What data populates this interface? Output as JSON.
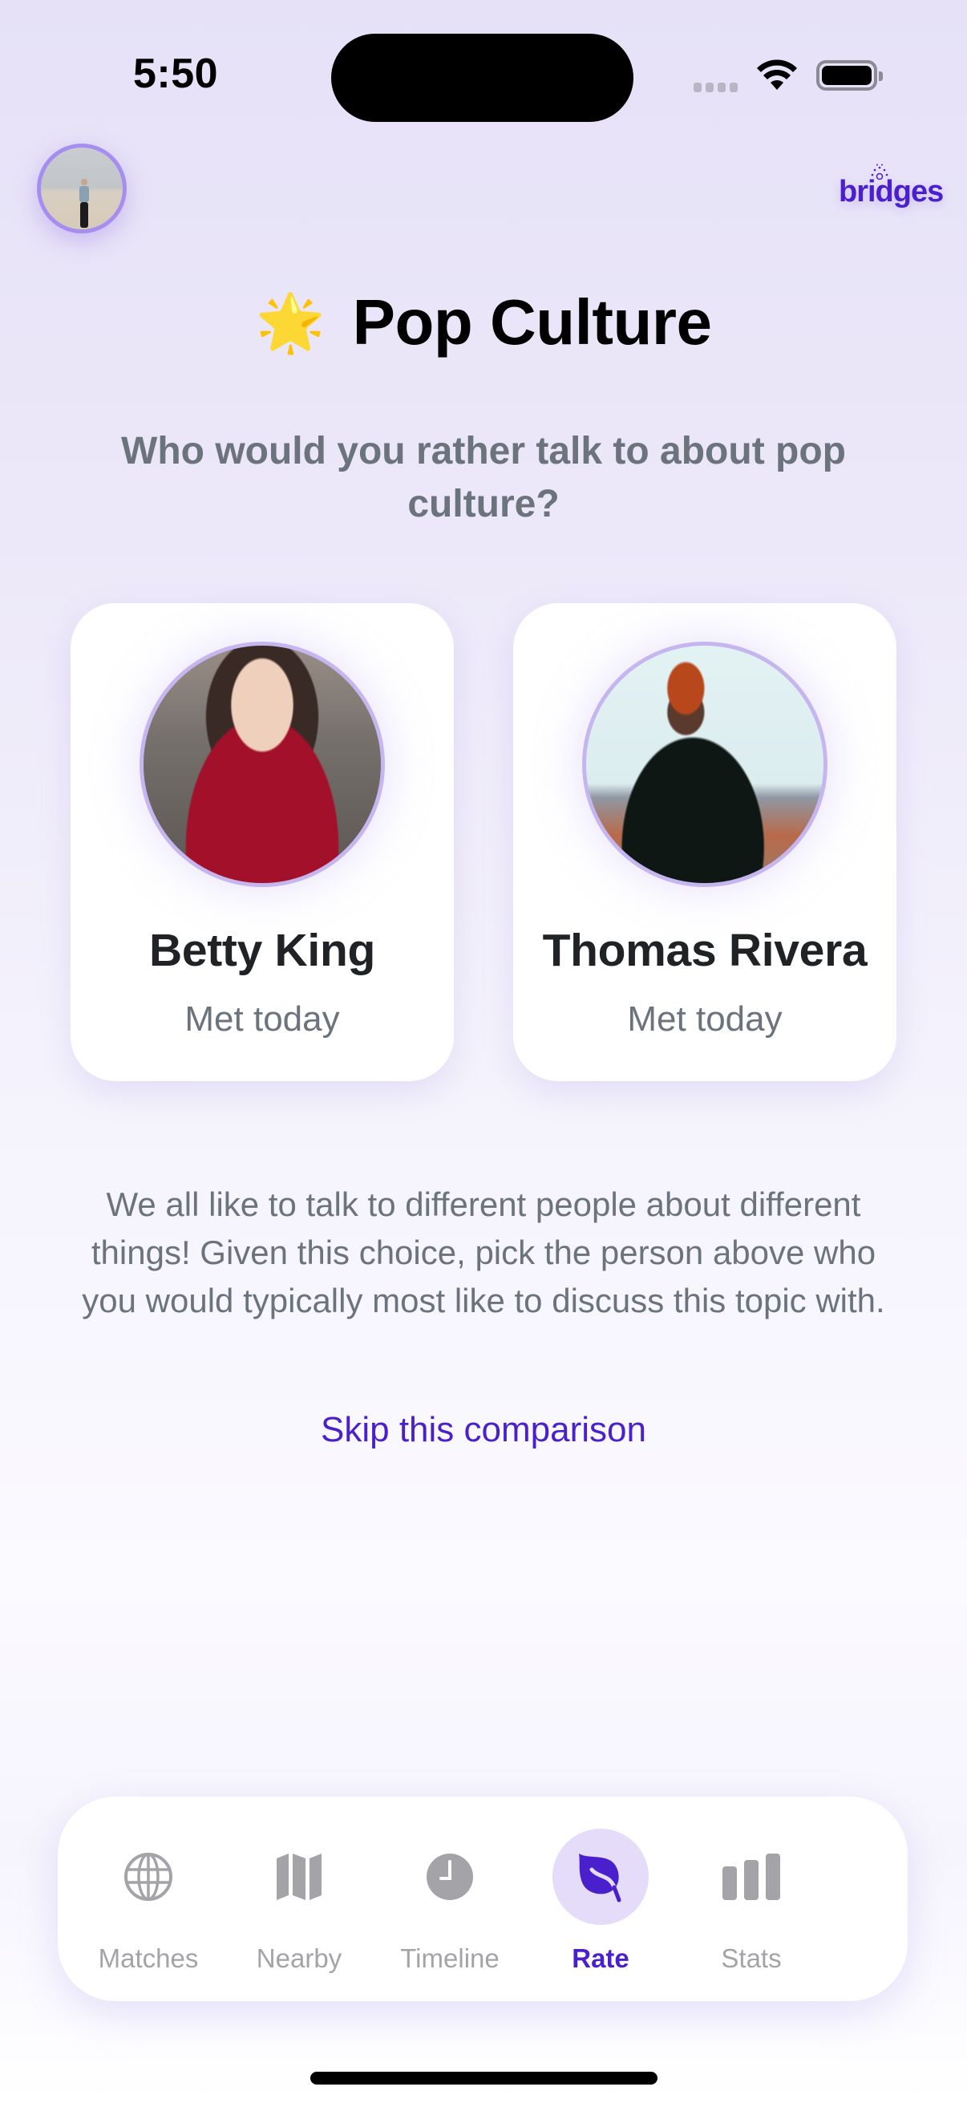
{
  "status_bar": {
    "time": "5:50",
    "icons": [
      "signal-icon",
      "wifi-icon",
      "battery-icon"
    ]
  },
  "header": {
    "avatar_alt": "User profile photo",
    "logo_text": "bridges"
  },
  "topic": {
    "emoji": "🌟",
    "title": "Pop Culture",
    "question": "Who would you rather talk to about pop culture?"
  },
  "people": [
    {
      "name": "Betty King",
      "met": "Met today"
    },
    {
      "name": "Thomas Rivera",
      "met": "Met today"
    }
  ],
  "description": "We all like to talk to different people about different things! Given this choice, pick the person above who you would typically most like to discuss this topic with.",
  "skip_label": "Skip this comparison",
  "tabs": [
    {
      "label": "Matches",
      "icon": "globe-icon",
      "active": false
    },
    {
      "label": "Nearby",
      "icon": "map-icon",
      "active": false
    },
    {
      "label": "Timeline",
      "icon": "clock-icon",
      "active": false
    },
    {
      "label": "Rate",
      "icon": "leaf-icon",
      "active": true
    },
    {
      "label": "Stats",
      "icon": "bar-chart-icon",
      "active": false
    }
  ],
  "colors": {
    "accent": "#4a1fcc",
    "inactive_tab": "#a3a3a8",
    "secondary_text": "#6b737c",
    "active_tab_bg": "#e4dcf8"
  }
}
